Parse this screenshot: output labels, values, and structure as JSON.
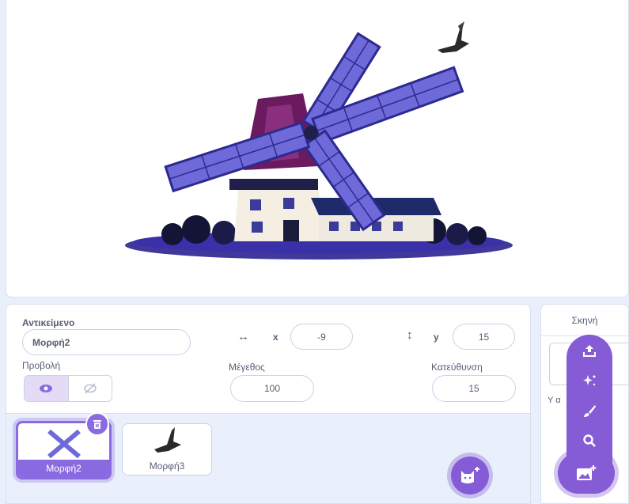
{
  "sprite_info": {
    "sprite_label": "Αντικείμενο",
    "sprite_name": "Μορφή2",
    "x_label": "x",
    "x_value": "-9",
    "y_label": "y",
    "y_value": "15",
    "show_label": "Προβολή",
    "size_label": "Μέγεθος",
    "size_value": "100",
    "direction_label": "Κατεύθυνση",
    "direction_value": "15"
  },
  "sprites": [
    {
      "name": "Μορφή2",
      "selected": true
    },
    {
      "name": "Μορφή3",
      "selected": false
    }
  ],
  "stage_panel": {
    "title": "Σκηνή",
    "backdrops_label": "Υ        α"
  },
  "icons": {
    "x_arrow": "horizontal-arrows-icon",
    "y_arrow": "vertical-arrows-icon",
    "show": "eye-icon",
    "hide": "eye-slash-icon",
    "delete": "trash-icon",
    "add_sprite": "cat-plus-icon",
    "upload": "upload-icon",
    "surprise": "sparkle-icon",
    "paint": "brush-icon",
    "search": "search-icon",
    "choose_backdrop": "image-plus-icon"
  },
  "colors": {
    "accent": "#855cd6",
    "selected": "#8a6ae0",
    "text": "#575e75"
  }
}
